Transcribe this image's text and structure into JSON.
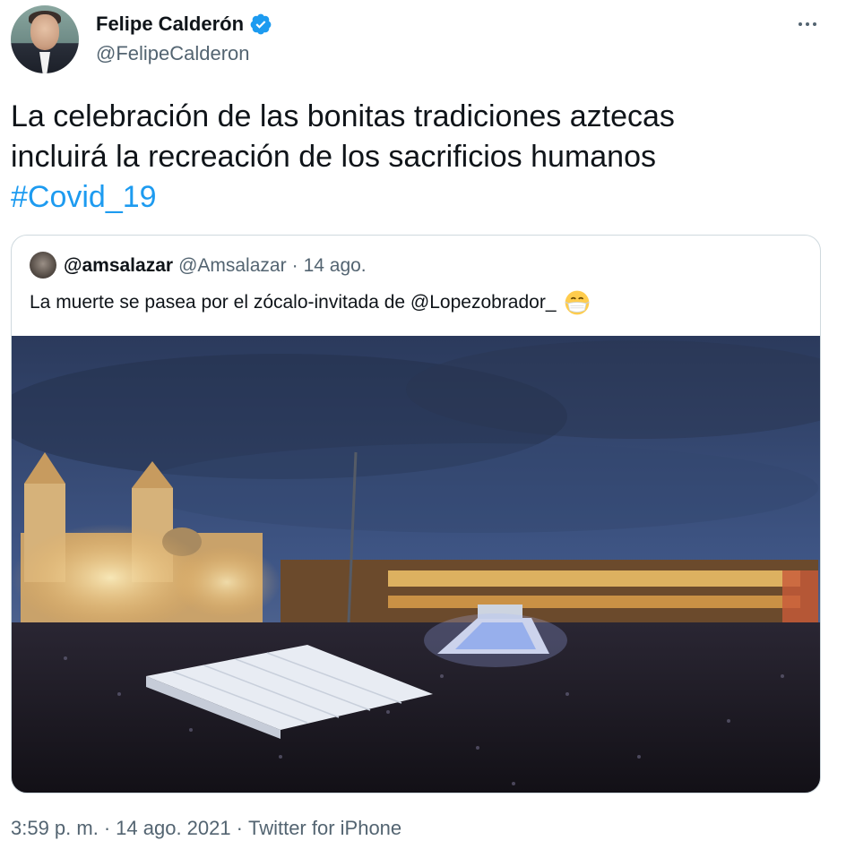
{
  "author": {
    "name": "Felipe Calderón",
    "handle": "@FelipeCalderon",
    "avatar_icon": "avatar-photo",
    "verified_icon": "verified-badge-icon",
    "verified_color": "#1d9bf0"
  },
  "tweet": {
    "text_line1": "La celebración de las bonitas tradiciones aztecas",
    "text_line2": "incluirá la recreación de los sacrificios humanos",
    "hashtag": "#Covid_19",
    "hashtag_color": "#1d9bf0"
  },
  "quoted": {
    "name": "@amsalazar",
    "handle": "@Amsalazar",
    "separator": "·",
    "date": "14 ago.",
    "text": "La muerte se pasea por el zócalo-invitada de @Lopezobrador_",
    "emoji": "face-with-medical-mask-emoji",
    "image": "zocalo-night-crowd-photo"
  },
  "footer": {
    "time": "3:59 p. m.",
    "separator1": "·",
    "date": "14 ago. 2021",
    "separator2": "·",
    "source": "Twitter for iPhone"
  },
  "more_icon": "more-options-icon"
}
